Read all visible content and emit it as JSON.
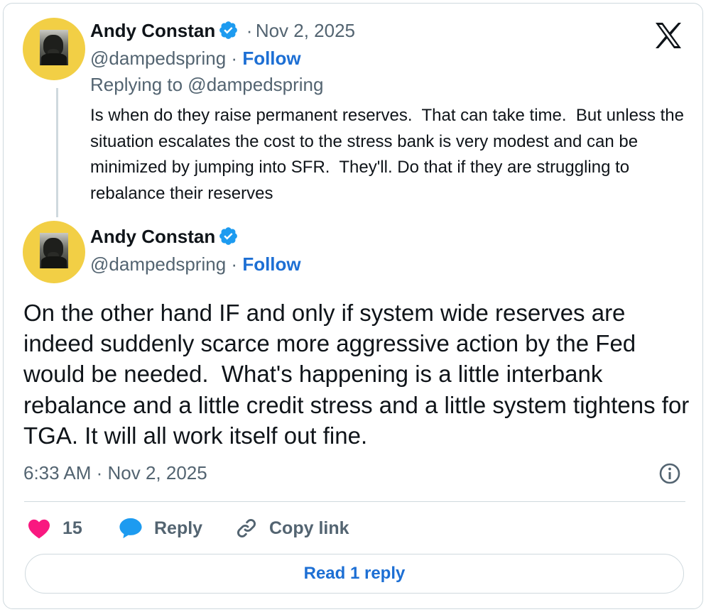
{
  "parent_tweet": {
    "author_name": "Andy Constan",
    "separator": "·",
    "date": "Nov 2, 2025",
    "handle": "@dampedspring",
    "follow_label": "Follow",
    "replying_to": "Replying to @dampedspring",
    "text": "Is when do they raise permanent reserves.  That can take time.  But unless the situation escalates the cost to the stress bank is very modest and can be minimized by jumping into SFR.  They'll. Do that if they are struggling to rebalance their reserves"
  },
  "main_tweet": {
    "author_name": "Andy Constan",
    "handle": "@dampedspring",
    "separator": "·",
    "follow_label": "Follow",
    "text": "On the other hand IF and only if system wide reserves are indeed suddenly scarce more aggressive action by the Fed would be needed.  What's happening is a little interbank rebalance and a little credit stress and a little system tightens for TGA. It will all work itself out fine.",
    "timestamp": "6:33 AM · Nov 2, 2025"
  },
  "actions": {
    "like_count": "15",
    "reply_label": "Reply",
    "copy_link_label": "Copy link"
  },
  "read_replies_label": "Read 1 reply",
  "icons": {
    "platform_logo": "x-logo-icon",
    "verified": "verified-badge-icon",
    "like": "heart-icon",
    "reply": "speech-bubble-icon",
    "copy_link": "link-icon",
    "info": "info-icon"
  },
  "colors": {
    "link_blue": "#1d6fd4",
    "verified_blue": "#1d9bf0",
    "heart_pink": "#f91880",
    "muted_text": "#536471",
    "avatar_background": "#f2cf45"
  }
}
